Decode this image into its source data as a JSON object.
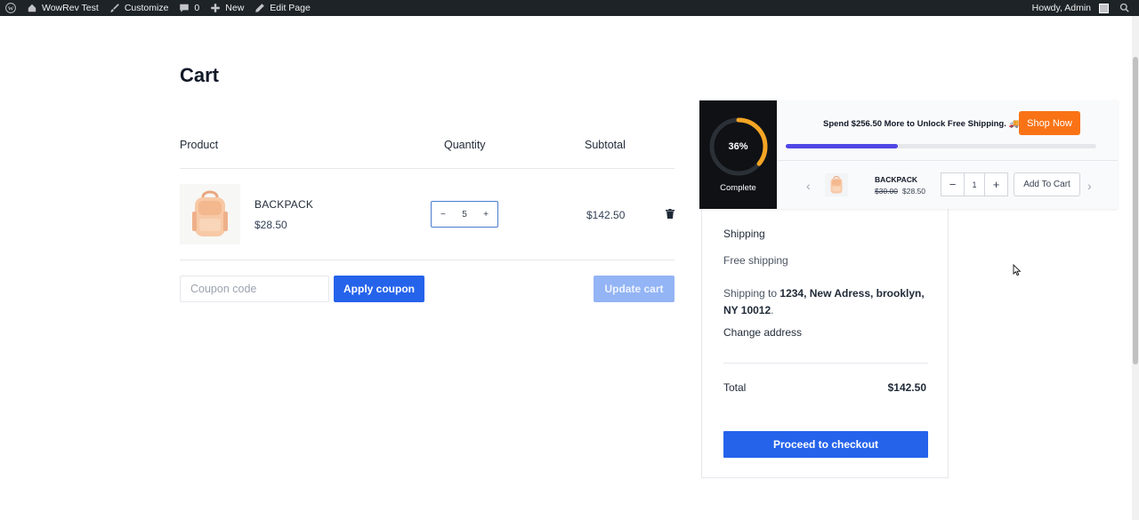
{
  "adminbar": {
    "site_name": "WowRev Test",
    "customize": "Customize",
    "comments_count": "0",
    "new": "New",
    "edit_page": "Edit Page",
    "greeting": "Howdy, Admin"
  },
  "cart": {
    "title": "Cart",
    "headers": {
      "product": "Product",
      "quantity": "Quantity",
      "subtotal": "Subtotal"
    },
    "item": {
      "name": "BACKPACK",
      "price": "$28.50",
      "quantity": "5",
      "qty_minus": "−",
      "qty_plus": "+",
      "subtotal": "$142.50"
    },
    "coupon_placeholder": "Coupon code",
    "apply_coupon": "Apply coupon",
    "update_cart": "Update cart"
  },
  "totals": {
    "shipping_label": "Shipping",
    "shipping_method": "Free shipping",
    "shipping_to_prefix": "Shipping to",
    "shipping_address_line1": "1234, New Adress, brooklyn,",
    "shipping_address_line2": "NY 10012",
    "shipping_address_suffix": ".",
    "change_address": "Change address",
    "total_label": "Total",
    "total_value": "$142.50",
    "checkout": "Proceed to checkout"
  },
  "popup": {
    "progress_percent": 36,
    "progress_label": "36%",
    "complete_label": "Complete",
    "message": "Spend $256.50 More to Unlock Free Shipping. 🚚",
    "shop_now": "Shop Now",
    "product": {
      "name": "BACKPACK",
      "old_price": "$30.00",
      "price": "$28.50",
      "quantity": "1",
      "qty_minus": "−",
      "qty_plus": "+",
      "add_to_cart": "Add To Cart"
    },
    "prev_arrow": "‹",
    "next_arrow": "›"
  },
  "colors": {
    "primary": "#2563eb",
    "primary_disabled": "#93b4f5",
    "accent_orange": "#f97316",
    "progress_ring": "#f5a524",
    "progress_bar": "#4f46e5",
    "adminbar_bg": "#1d2327"
  },
  "icons": [
    "wordpress-icon",
    "home-icon",
    "brush-icon",
    "comment-icon",
    "plus-icon",
    "pencil-icon",
    "search-icon",
    "trash-icon",
    "backpack-icon",
    "chevron-left-icon",
    "chevron-right-icon",
    "cursor-icon"
  ]
}
